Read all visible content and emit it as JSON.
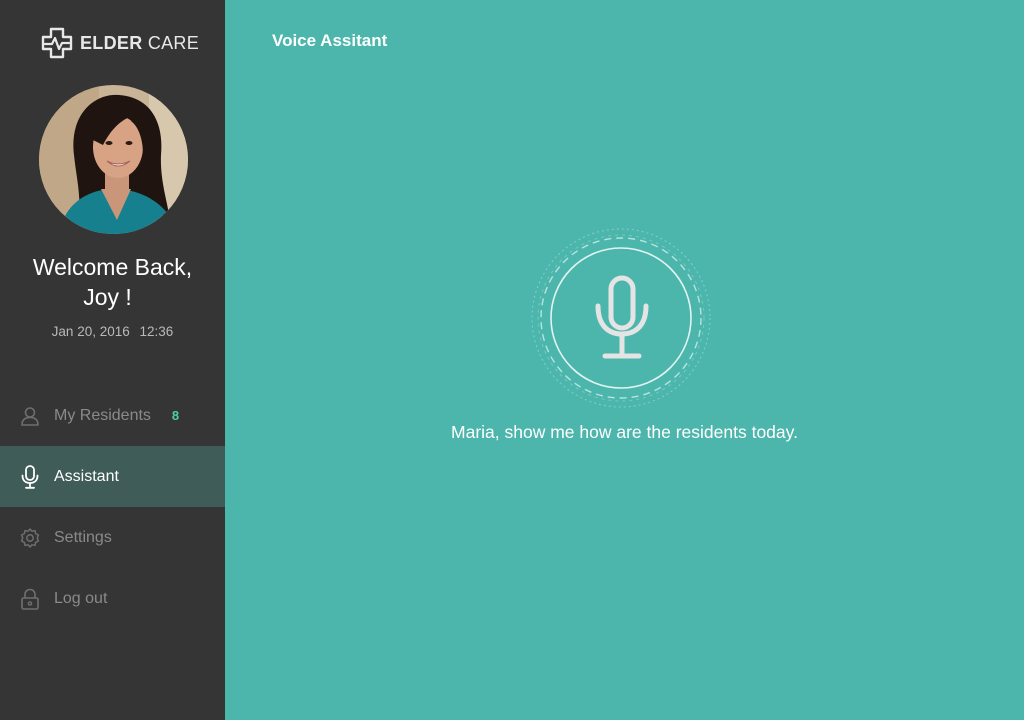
{
  "brand": {
    "name_bold": "ELDER",
    "name_regular": " CARE",
    "logo_icon": "heart-cross-logo-icon"
  },
  "user": {
    "welcome_line1": "Welcome Back,",
    "welcome_line2": "Joy !",
    "date": "Jan 20, 2016",
    "time": "12:36"
  },
  "nav": {
    "items": [
      {
        "label": "My Residents",
        "icon": "user-icon",
        "badge": "8",
        "active": false
      },
      {
        "label": "Assistant",
        "icon": "microphone-icon",
        "active": true
      },
      {
        "label": "Settings",
        "icon": "gear-icon",
        "active": false
      },
      {
        "label": "Log out",
        "icon": "lock-icon",
        "active": false
      }
    ]
  },
  "main": {
    "title": "Voice Assitant",
    "prompt": "Maria, show me how are the residents today."
  },
  "colors": {
    "sidebar_bg": "#353535",
    "active_item_bg": "#3f5c58",
    "main_bg": "#4db6ac",
    "badge": "#4ecdab"
  }
}
